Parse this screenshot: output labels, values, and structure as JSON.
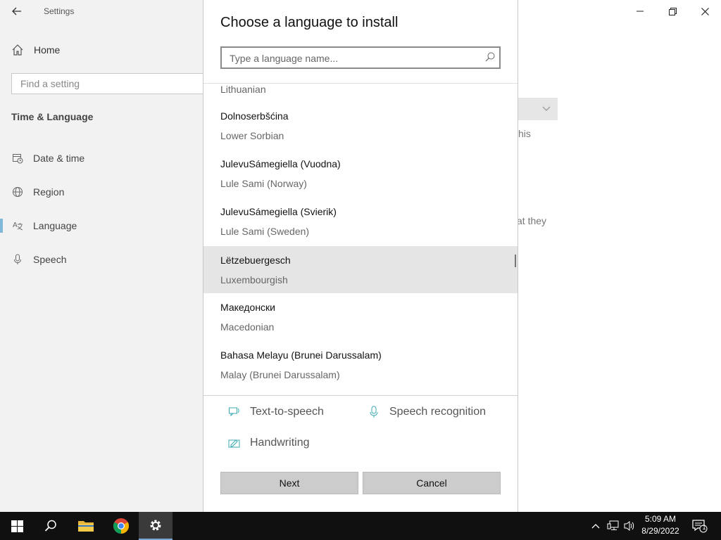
{
  "window": {
    "app_title": "Settings",
    "home_label": "Home",
    "find_placeholder": "Find a setting",
    "section_title": "Time & Language",
    "nav_items": [
      {
        "label": "Date & time",
        "icon": "calendar-clock-icon"
      },
      {
        "label": "Region",
        "icon": "globe-icon"
      },
      {
        "label": "Language",
        "icon": "language-icon",
        "selected": true
      },
      {
        "label": "Speech",
        "icon": "microphone-icon"
      }
    ],
    "bg_fragments": {
      "frag1": "his",
      "frag2": "at they"
    },
    "accent_color": "#7fb8d8"
  },
  "dialog": {
    "title": "Choose a language to install",
    "search_placeholder": "Type a language name...",
    "partial_top": "Lithuanian",
    "languages": [
      {
        "native": "Dolnoserbšćina",
        "english": "Lower Sorbian"
      },
      {
        "native": "JulevuSámegiella (Vuodna)",
        "english": "Lule Sami (Norway)"
      },
      {
        "native": "JulevuSámegiella (Svierik)",
        "english": "Lule Sami (Sweden)"
      },
      {
        "native": "Lëtzebuergesch",
        "english": "Luxembourgish",
        "selected": true
      },
      {
        "native": "Македонски",
        "english": "Macedonian"
      },
      {
        "native": "Bahasa Melayu (Brunei Darussalam)",
        "english": "Malay (Brunei Darussalam)"
      }
    ],
    "features": {
      "tts": "Text-to-speech",
      "speech": "Speech recognition",
      "handwriting": "Handwriting"
    },
    "next_label": "Next",
    "cancel_label": "Cancel"
  },
  "taskbar": {
    "time": "5:09 AM",
    "date": "8/29/2022",
    "notification_count": "1"
  }
}
